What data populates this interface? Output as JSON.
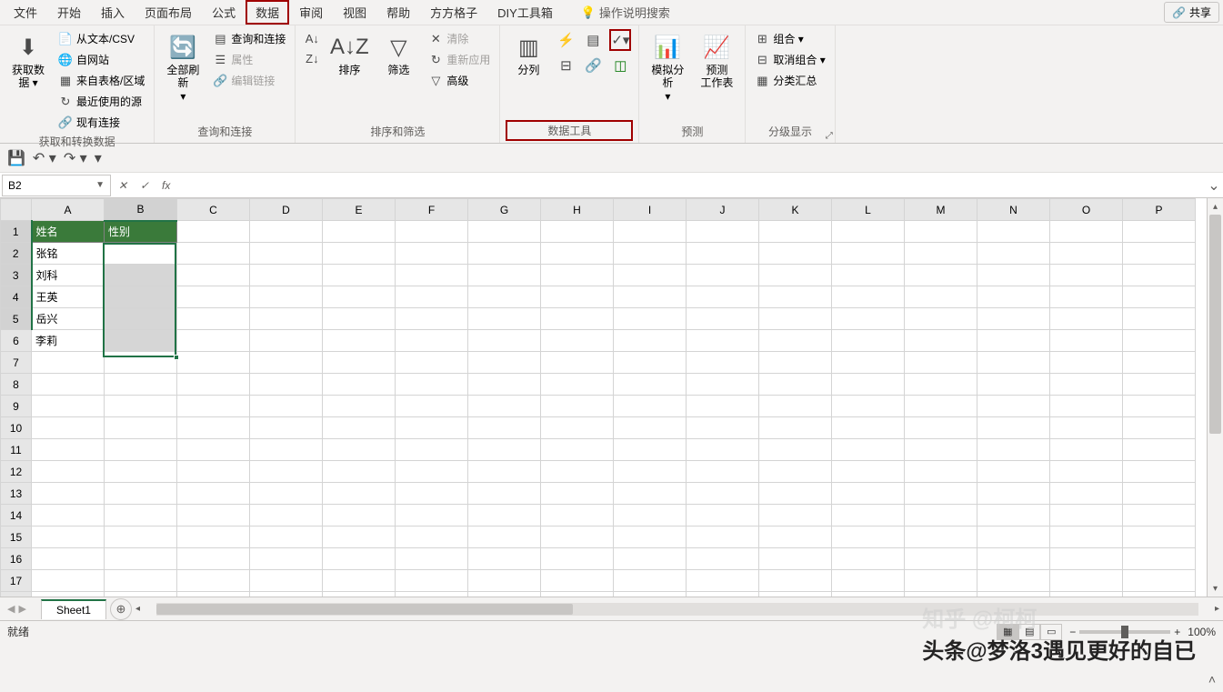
{
  "menu": {
    "items": [
      "文件",
      "开始",
      "插入",
      "页面布局",
      "公式",
      "数据",
      "审阅",
      "视图",
      "帮助",
      "方方格子",
      "DIY工具箱"
    ],
    "active_index": 5,
    "search_placeholder": "操作说明搜索",
    "share": "共享"
  },
  "ribbon": {
    "groups": [
      {
        "label": "获取和转换数据",
        "large": [
          {
            "icon": "⬇",
            "text": "获取数\n据 ▾"
          }
        ],
        "small": [
          {
            "icon": "📄",
            "text": "从文本/CSV"
          },
          {
            "icon": "🌐",
            "text": "自网站"
          },
          {
            "icon": "▦",
            "text": "来自表格/区域"
          },
          {
            "icon": "↻",
            "text": "最近使用的源"
          },
          {
            "icon": "🔗",
            "text": "现有连接"
          }
        ]
      },
      {
        "label": "查询和连接",
        "large": [
          {
            "icon": "🔄",
            "text": "全部刷新\n▾"
          }
        ],
        "small": [
          {
            "icon": "▤",
            "text": "查询和连接"
          },
          {
            "icon": "☰",
            "text": "属性",
            "disabled": true
          },
          {
            "icon": "🔗",
            "text": "编辑链接",
            "disabled": true
          }
        ]
      },
      {
        "label": "排序和筛选",
        "large": [
          {
            "icon": "A↓Z",
            "text": "排序"
          },
          {
            "icon": "▽",
            "text": "筛选"
          }
        ],
        "pre_small": [
          {
            "icon": "A↓",
            "text": ""
          },
          {
            "icon": "Z↓",
            "text": ""
          }
        ],
        "small": [
          {
            "icon": "✕",
            "text": "清除",
            "disabled": true
          },
          {
            "icon": "↻",
            "text": "重新应用",
            "disabled": true
          },
          {
            "icon": "▽",
            "text": "高级"
          }
        ]
      },
      {
        "label": "数据工具",
        "highlight": true,
        "large": [
          {
            "icon": "▥",
            "text": "分列"
          }
        ],
        "icons": [
          {
            "icon": "⚡",
            "name": "flash-fill-icon"
          },
          {
            "icon": "▤",
            "name": "remove-dup-icon"
          },
          {
            "icon": "✓",
            "name": "data-validation-icon",
            "highlight": true,
            "dropdown": true
          },
          {
            "icon": "⊟",
            "name": "consolidate-icon"
          },
          {
            "icon": "🔗",
            "name": "relationships-icon"
          },
          {
            "icon": "◫",
            "name": "data-model-icon",
            "green": true
          }
        ]
      },
      {
        "label": "预测",
        "large": [
          {
            "icon": "📊",
            "text": "模拟分析\n▾"
          },
          {
            "icon": "📈",
            "text": "预测\n工作表"
          }
        ]
      },
      {
        "label": "分级显示",
        "small": [
          {
            "icon": "⊞",
            "text": "组合 ▾"
          },
          {
            "icon": "⊟",
            "text": "取消组合 ▾"
          },
          {
            "icon": "▦",
            "text": "分类汇总"
          }
        ],
        "launcher": true
      }
    ]
  },
  "qat": {
    "buttons": [
      "save",
      "undo",
      "redo",
      "customize"
    ]
  },
  "formula_bar": {
    "name_box": "B2",
    "fx": "fx"
  },
  "grid": {
    "columns": [
      "A",
      "B",
      "C",
      "D",
      "E",
      "F",
      "G",
      "H",
      "I",
      "J",
      "K",
      "L",
      "M",
      "N",
      "O",
      "P"
    ],
    "rows": 18,
    "selected_col": 1,
    "selected_rows": [
      1,
      2,
      3,
      4,
      5
    ],
    "active_cell": "B2",
    "header_row": {
      "A": "姓名",
      "B": "性别"
    },
    "data": [
      {
        "A": "张铭"
      },
      {
        "A": "刘科"
      },
      {
        "A": "王英"
      },
      {
        "A": "岳兴"
      },
      {
        "A": "李莉"
      }
    ]
  },
  "sheets": {
    "active": "Sheet1"
  },
  "status": {
    "ready": "就绪",
    "zoom": "100%"
  },
  "watermark": "头条@梦洛3遇见更好的自已"
}
